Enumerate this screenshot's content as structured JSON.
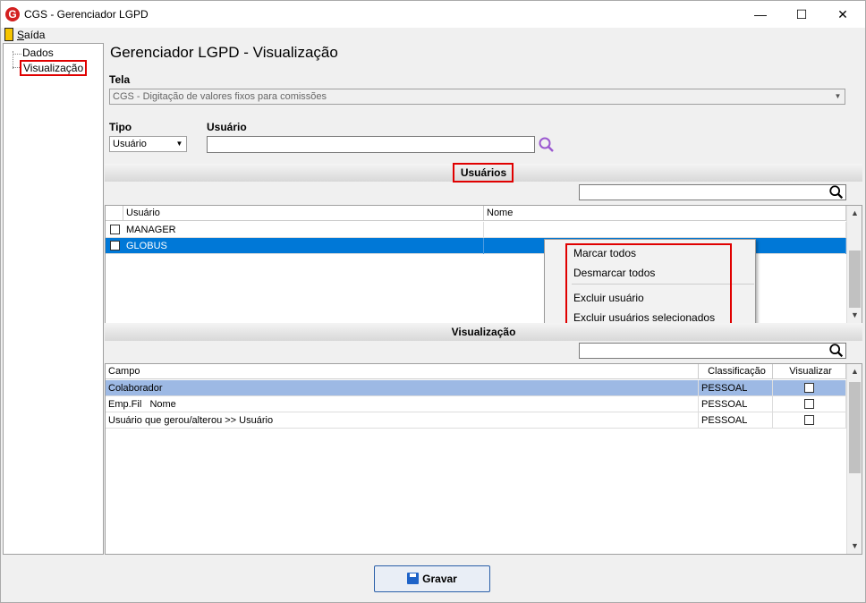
{
  "window": {
    "title": "CGS - Gerenciador LGPD",
    "app_icon_letter": "G",
    "minimize": "—",
    "maximize": "☐",
    "close": "✕"
  },
  "menu": {
    "saida_first": "S",
    "saida_rest": "aída"
  },
  "tree": {
    "items": [
      {
        "label": "Dados"
      },
      {
        "label": "Visualização"
      }
    ]
  },
  "main": {
    "title": "Gerenciador LGPD - Visualização",
    "tela_label": "Tela",
    "tela_value": "CGS - Digitação de valores fixos para comissões",
    "tipo_label": "Tipo",
    "tipo_value": "Usuário",
    "usuario_label": "Usuário",
    "usuario_value": ""
  },
  "usuarios_section": {
    "title": "Usuários",
    "search_value": "",
    "columns": [
      "Usuário",
      "Nome"
    ],
    "rows": [
      {
        "usuario": "MANAGER",
        "nome": "",
        "checked": false,
        "selected": false
      },
      {
        "usuario": "GLOBUS",
        "nome": "",
        "checked": false,
        "selected": true
      }
    ]
  },
  "context_menu": {
    "items": [
      "Marcar todos",
      "Desmarcar todos",
      "Excluir usuário",
      "Excluir usuários selecionados"
    ]
  },
  "visualizacao_section": {
    "title": "Visualização",
    "search_value": "",
    "columns": [
      "Campo",
      "Classificação",
      "Visualizar"
    ],
    "rows": [
      {
        "campo": "Colaborador",
        "classificacao": "PESSOAL",
        "visualizar": false,
        "selected": true
      },
      {
        "campo": "Emp.Fil   Nome",
        "classificacao": "PESSOAL",
        "visualizar": false,
        "selected": false
      },
      {
        "campo": "Usuário que gerou/alterou >> Usuário",
        "classificacao": "PESSOAL",
        "visualizar": false,
        "selected": false
      }
    ]
  },
  "footer": {
    "gravar_label": "Gravar"
  },
  "colors": {
    "selection_blue": "#0078d7",
    "row_highlight": "#9db9e4",
    "annotation_red": "#e00000"
  }
}
